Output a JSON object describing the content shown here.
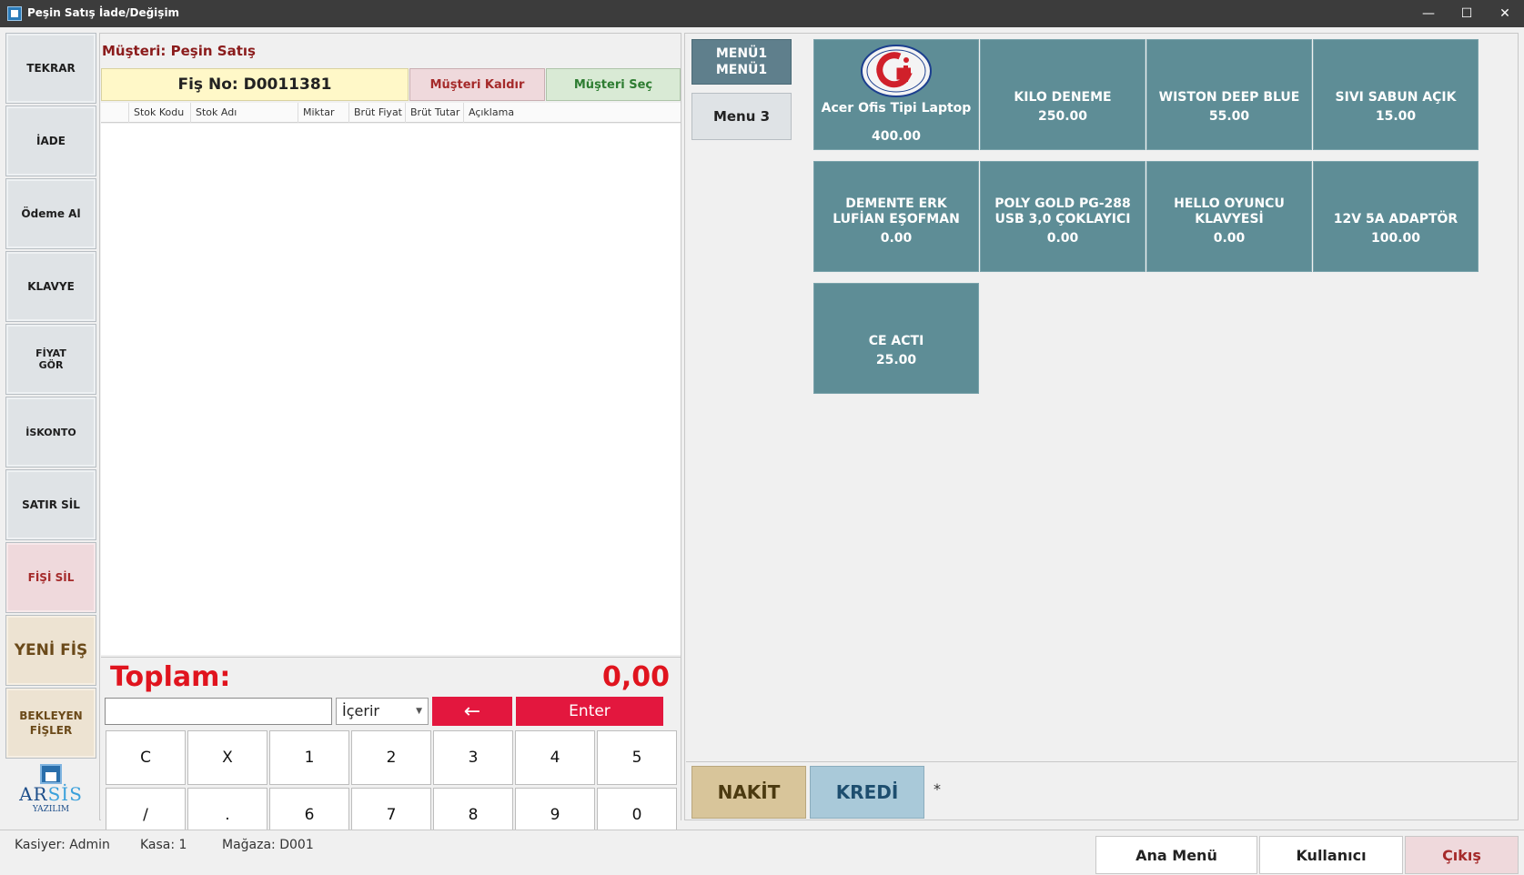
{
  "window": {
    "title": "Peşin Satış İade/Değişim",
    "controls": [
      "—",
      "☐",
      "✕"
    ]
  },
  "left_buttons": [
    {
      "label": "TEKRAR",
      "variant": "normal"
    },
    {
      "label": "İADE",
      "variant": "normal"
    },
    {
      "label": "Ödeme Al",
      "variant": "normal"
    },
    {
      "label": "KLAVYE",
      "variant": "normal"
    },
    {
      "label": "FİYAT\nGÖR",
      "variant": "normal"
    },
    {
      "label": "İSKONTO",
      "variant": "normal"
    },
    {
      "label": "SATIR SİL",
      "variant": "normal"
    },
    {
      "label": "FİŞİ SİL",
      "variant": "pink"
    },
    {
      "label": "YENİ FİŞ",
      "variant": "beige-big"
    },
    {
      "label": "BEKLEYEN\nFİŞLER",
      "variant": "beige"
    }
  ],
  "logo": {
    "text_a": "AR",
    "text_b": "SİS",
    "sub": "YAZILIM"
  },
  "sale": {
    "customer_label": "Müşteri: Peşin Satış",
    "receipt_no": "Fiş No: D0011381",
    "remove_customer": "Müşteri Kaldır",
    "select_customer": "Müşteri Seç",
    "columns": [
      "",
      "Stok Kodu",
      "Stok Adı",
      "Miktar",
      "Brüt Fiyat",
      "Brüt Tutar",
      "Açıklama"
    ],
    "rows": [],
    "total_label": "Toplam:",
    "total_value": "0,00",
    "search_value": "",
    "filter_value": "İçerir",
    "back_label": "←",
    "enter_label": "Enter"
  },
  "keypad": {
    "row1": [
      "C",
      "X",
      "1",
      "2",
      "3",
      "4",
      "5"
    ],
    "row2": [
      "/",
      ".",
      "6",
      "7",
      "8",
      "9",
      "0"
    ]
  },
  "menus": [
    {
      "label": "MENÜ1\nMENÜ1",
      "active": true
    },
    {
      "label": "Menu 3",
      "active": false
    }
  ],
  "products": [
    {
      "name": "Acer Ofis Tipi Laptop",
      "price": "400.00",
      "image": "logo-circle-icon"
    },
    {
      "name": "KILO DENEME",
      "price": "250.00"
    },
    {
      "name": "WISTON DEEP BLUE",
      "price": "55.00"
    },
    {
      "name": "SIVI SABUN AÇIK",
      "price": "15.00"
    },
    {
      "name": "DEMENTE ERK LUFİAN EŞOFMAN",
      "price": "0.00"
    },
    {
      "name": "POLY GOLD PG-288 USB 3,0 ÇOKLAYICI",
      "price": "0.00"
    },
    {
      "name": "HELLO OYUNCU KLAVYESİ",
      "price": "0.00"
    },
    {
      "name": "12V 5A ADAPTÖR",
      "price": "100.00"
    },
    {
      "name": "CE ACTI",
      "price": "25.00"
    }
  ],
  "payment": {
    "cash": "NAKİT",
    "credit": "KREDİ",
    "note": "*"
  },
  "status": {
    "cashier": "Kasiyer: Admin",
    "register": "Kasa: 1",
    "store": "Mağaza: D001",
    "main_menu": "Ana Menü",
    "user": "Kullanıcı",
    "exit": "Çıkış"
  },
  "colors": {
    "tile": "#5e8d96",
    "accent_red": "#e3173e",
    "total_red": "#e0141e"
  }
}
